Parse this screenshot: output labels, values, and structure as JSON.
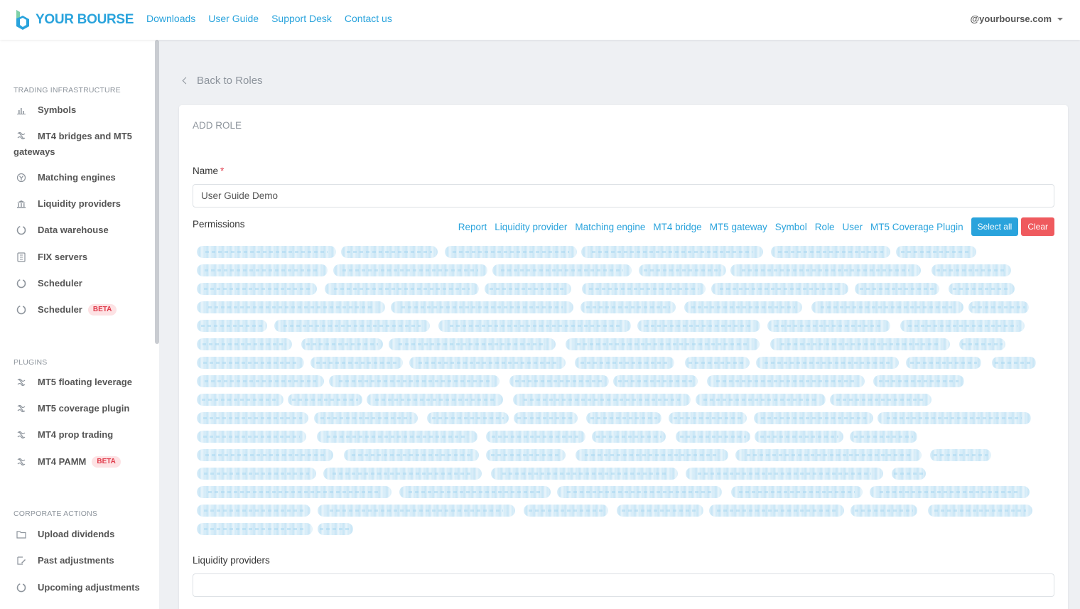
{
  "header": {
    "logo_text": "YOUR BOURSE",
    "nav": [
      "Downloads",
      "User Guide",
      "Support Desk",
      "Contact us"
    ],
    "account": "@yourbourse.com"
  },
  "sidebar": {
    "sections": [
      {
        "title": "TRADING INFRASTRUCTURE",
        "items": [
          {
            "label": "Symbols",
            "icon": "bar-chart-icon"
          },
          {
            "label": "MT4 bridges and MT5 gateways",
            "icon": "bridge-icon"
          },
          {
            "label": "Matching engines",
            "icon": "matching-engine-icon"
          },
          {
            "label": "Liquidity providers",
            "icon": "bank-icon"
          },
          {
            "label": "Data warehouse",
            "icon": "circle-icon"
          },
          {
            "label": "FIX servers",
            "icon": "server-icon"
          },
          {
            "label": "Scheduler",
            "icon": "circle-icon"
          },
          {
            "label": "Scheduler",
            "icon": "circle-icon",
            "badge": "BETA"
          }
        ]
      },
      {
        "title": "PLUGINS",
        "items": [
          {
            "label": "MT5 floating leverage",
            "icon": "plugin-icon"
          },
          {
            "label": "MT5 coverage plugin",
            "icon": "plugin-icon"
          },
          {
            "label": "MT4 prop trading",
            "icon": "plugin-icon"
          },
          {
            "label": "MT4 PAMM",
            "icon": "plugin-icon",
            "badge": "BETA"
          }
        ]
      },
      {
        "title": "CORPORATE ACTIONS",
        "items": [
          {
            "label": "Upload dividends",
            "icon": "folder-icon"
          },
          {
            "label": "Past adjustments",
            "icon": "edit-icon"
          },
          {
            "label": "Upcoming adjustments",
            "icon": "circle-icon"
          }
        ]
      }
    ]
  },
  "main": {
    "back_label": "Back to Roles",
    "card_title": "ADD ROLE",
    "name_label": "Name",
    "name_required_mark": "*",
    "name_value": "User Guide Demo",
    "permissions_label": "Permissions",
    "permission_filters": [
      "Report",
      "Liquidity provider",
      "Matching engine",
      "MT4 bridge",
      "MT5 gateway",
      "Symbol",
      "Role",
      "User",
      "MT5 Coverage Plugin"
    ],
    "select_all_label": "Select all",
    "clear_label": "Clear",
    "liquidity_providers_label": "Liquidity providers",
    "liquidity_providers_value": ""
  },
  "colors": {
    "accent": "#29a3dc",
    "danger": "#ef5a5e",
    "badge_bg": "#fde2e4",
    "badge_text": "#e03a4a"
  }
}
